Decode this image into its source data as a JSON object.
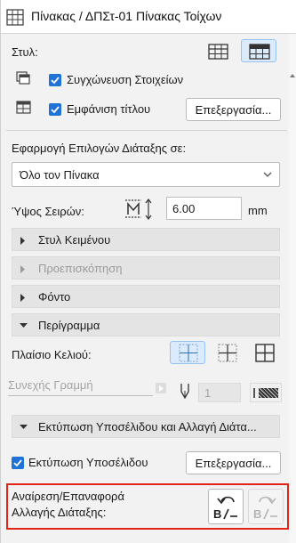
{
  "window": {
    "title": "Πίνακας / ΔΠΣτ-01 Πίνακας Τοίχων"
  },
  "style_row": {
    "label": "Στυλ:"
  },
  "merge": {
    "label": "Συγχώνευση Στοιχείων",
    "checked": true
  },
  "show_title": {
    "label": "Εμφάνιση τίτλου",
    "checked": true,
    "edit_label": "Επεξεργασία..."
  },
  "apply_options": {
    "label": "Εφαρμογή Επιλογών Διάταξης σε:",
    "value": "Όλο τον Πίνακα"
  },
  "row_height": {
    "label": "Ύψος Σειρών:",
    "value": "6.00",
    "unit": "mm"
  },
  "sections": {
    "text_style": "Στυλ Κειμένου",
    "preview": "Προεπισκόπηση",
    "background": "Φόντο",
    "border": "Περίγραμμα",
    "footer": "Εκτύπωση Υποσέλιδου και Αλλαγή Διάτα..."
  },
  "cell_frame": {
    "label": "Πλαίσιο Κελιού:"
  },
  "line_type": {
    "value": "Συνεχής Γραμμή"
  },
  "pen": {
    "value": "1"
  },
  "print_footer": {
    "label": "Εκτύπωση Υποσέλιδου",
    "checked": true,
    "edit_label": "Επεξεργασία..."
  },
  "undo_redo": {
    "label_line1": "Αναίρεση/Επαναφορά",
    "label_line2": "Αλλαγής Διάταξης:"
  },
  "colors": {
    "accent": "#1f73d6",
    "highlight_frame": "#e2231a",
    "section_bg": "#e4e4e4"
  }
}
